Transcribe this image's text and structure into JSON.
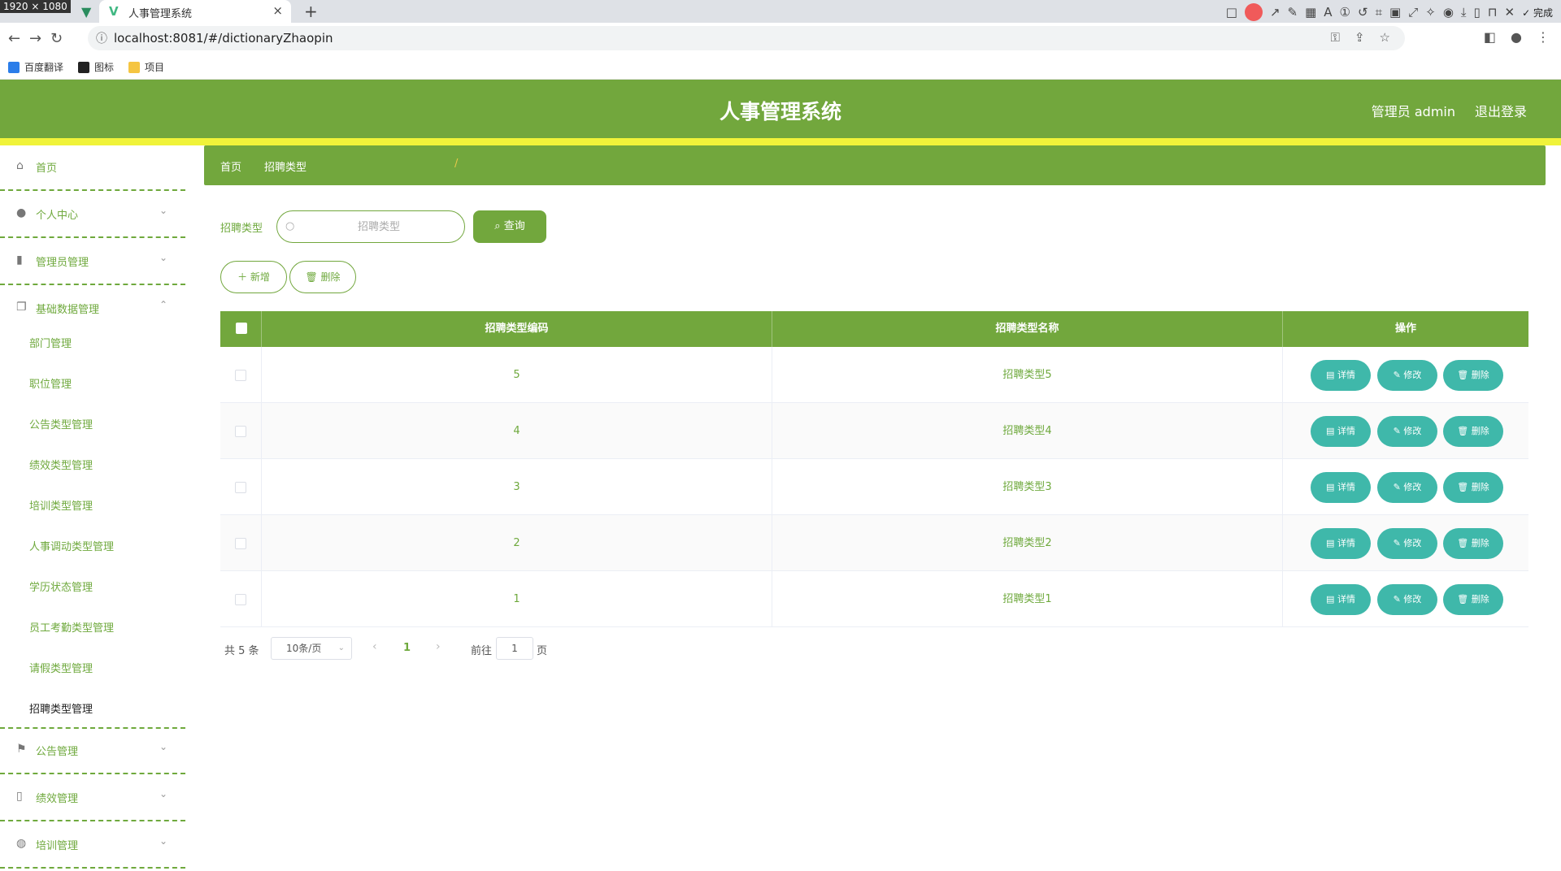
{
  "browser": {
    "dimension_badge": "1920 × 1080",
    "tab_title": "人事管理系统",
    "url": "localhost:8081/#/dictionaryZhaopin",
    "done_label": "完成",
    "bookmarks": [
      "百度翻译",
      "图标",
      "项目"
    ]
  },
  "header": {
    "title": "人事管理系统",
    "admin_label": "管理员 admin",
    "logout_label": "退出登录"
  },
  "sidebar": {
    "menus": [
      {
        "label": "首页",
        "icon": "home-icon"
      },
      {
        "label": "个人中心",
        "icon": "user-icon"
      },
      {
        "label": "管理员管理",
        "icon": "chart-icon"
      },
      {
        "label": "基础数据管理",
        "icon": "copy-icon"
      },
      {
        "label": "公告管理",
        "icon": "flag-icon"
      },
      {
        "label": "绩效管理",
        "icon": "mobile-icon"
      },
      {
        "label": "培训管理",
        "icon": "globe-icon"
      }
    ],
    "submenu": [
      "部门管理",
      "职位管理",
      "公告类型管理",
      "绩效类型管理",
      "培训类型管理",
      "人事调动类型管理",
      "学历状态管理",
      "员工考勤类型管理",
      "请假类型管理",
      "招聘类型管理"
    ]
  },
  "breadcrumb": {
    "home": "首页",
    "separator": "/",
    "current": "招聘类型"
  },
  "search": {
    "label": "招聘类型",
    "placeholder": "招聘类型",
    "button_label": "查询"
  },
  "actions": {
    "add_label": "新增",
    "delete_label": "删除"
  },
  "table": {
    "headers": [
      "招聘类型编码",
      "招聘类型名称",
      "操作"
    ],
    "rows": [
      {
        "code": "5",
        "name": "招聘类型5"
      },
      {
        "code": "4",
        "name": "招聘类型4"
      },
      {
        "code": "3",
        "name": "招聘类型3"
      },
      {
        "code": "2",
        "name": "招聘类型2"
      },
      {
        "code": "1",
        "name": "招聘类型1"
      }
    ],
    "row_actions": {
      "detail": "详情",
      "edit": "修改",
      "delete": "删除"
    }
  },
  "pagination": {
    "total_label": "共 5 条",
    "page_size": "10条/页",
    "current_page": "1",
    "goto_label": "前往",
    "goto_value": "1",
    "page_suffix": "页"
  },
  "colors": {
    "primary_green": "#72a73d",
    "accent_yellow": "#f0f33a",
    "action_teal": "#3fb8aa"
  }
}
